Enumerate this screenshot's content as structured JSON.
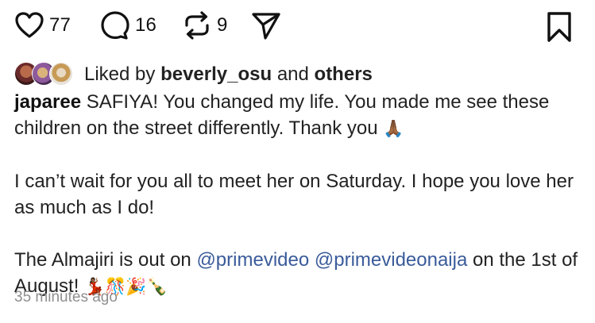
{
  "actions": {
    "likes": "77",
    "comments": "16",
    "reposts": "9"
  },
  "liked_by": {
    "prefix": "Liked by",
    "user": "beverly_osu",
    "middle": "and",
    "others": "others"
  },
  "caption": {
    "username": "japaree",
    "line1": "SAFIYA! You changed my life. You made me see these children on the street differently. Thank you",
    "line1_emoji": "🙏🏾",
    "para2": "I can’t wait for you all to meet her on Saturday. I hope you love her as much as I do!",
    "para3_start": "The Almajiri is out on",
    "mention1": "@primevideo",
    "mention2": "@primevideonaija",
    "para3_end": "on the 1st of August!",
    "para3_emoji": "💃🏾🎊🎉🍾"
  },
  "timestamp": "35 minutes ago",
  "colors": {
    "mention": "#3a5b9a",
    "timestamp": "#8e8e8e",
    "text": "#222222"
  }
}
